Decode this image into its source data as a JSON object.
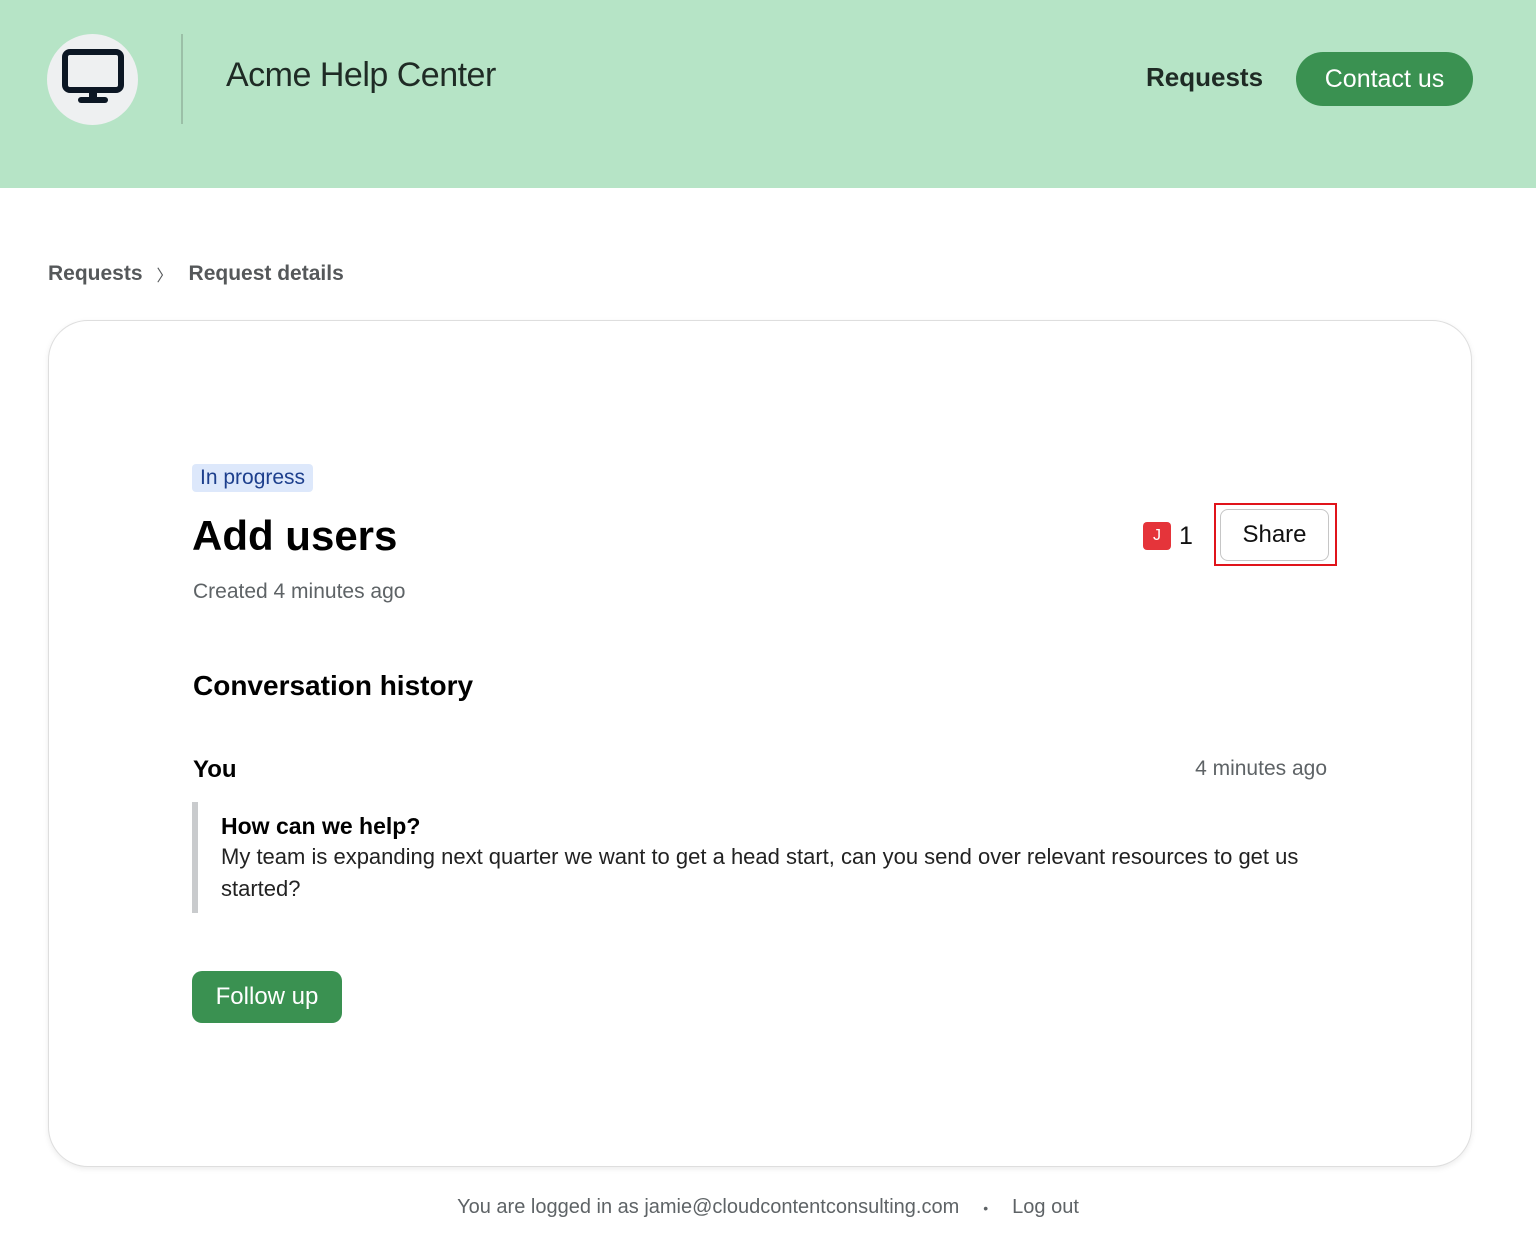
{
  "header": {
    "site_title": "Acme Help Center",
    "nav_requests": "Requests",
    "contact_label": "Contact us",
    "logo_icon": "monitor-icon",
    "background": "#b6e4c6",
    "accent": "#3a9151"
  },
  "breadcrumb": {
    "items": [
      "Requests",
      "Request details"
    ],
    "separator": "〉"
  },
  "request": {
    "status": "In progress",
    "title": "Add users",
    "created": "Created 4 minutes ago",
    "participant_initial": "J",
    "participant_count": "1",
    "share_label": "Share"
  },
  "conversation": {
    "heading": "Conversation history",
    "messages": [
      {
        "author": "You",
        "time": "4 minutes ago",
        "heading": "How can we help?",
        "body": "My team is expanding next quarter we want to get a head start, can you send over relevant resources to get us started?"
      }
    ],
    "follow_up_label": "Follow up"
  },
  "footer": {
    "logged_in_text": "You are logged in as jamie@cloudcontentconsulting.com",
    "separator": "•",
    "logout_label": "Log out"
  }
}
